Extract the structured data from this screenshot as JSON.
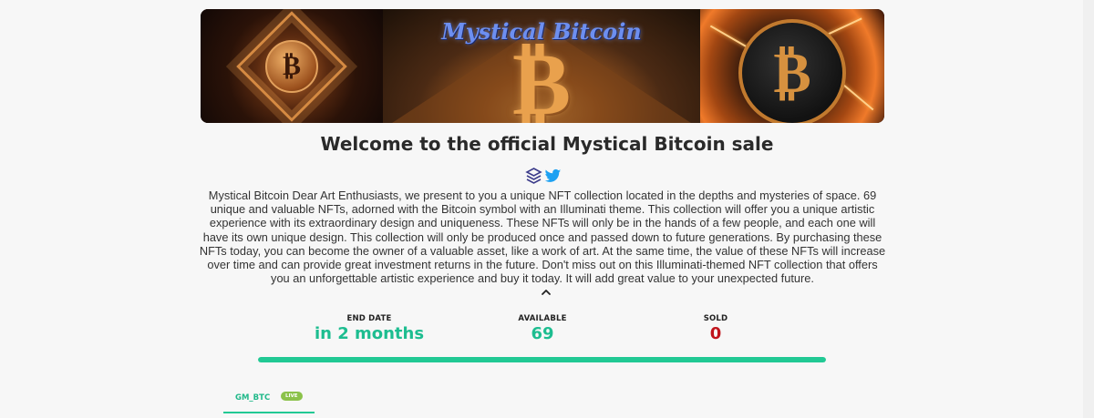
{
  "banner": {
    "title": "Mystical Bitcoin",
    "coin_symbol": "₿"
  },
  "heading": "Welcome to the official Mystical Bitcoin sale",
  "socials": {
    "items": [
      {
        "icon": "layers-icon",
        "color": "#3b3b8a"
      },
      {
        "icon": "twitter-icon",
        "color": "#1da1f2"
      }
    ]
  },
  "description": "Mystical Bitcoin Dear Art Enthusiasts, we present to you a unique NFT collection located in the depths and mysteries of space. 69 unique and valuable NFTs, adorned with the Bitcoin symbol with an Illuminati theme. This collection will offer you a unique artistic experience with its extraordinary design and uniqueness. These NFTs will only be in the hands of a few people, and each one will have its own unique design. This collection will only be produced once and passed down to future generations. By purchasing these NFTs today, you can become the owner of a valuable asset, like a work of art. At the same time, the value of these NFTs will increase over time and can provide great investment returns in the future. Don't miss out on this Illuminati-themed NFT collection that offers you an unforgettable artistic experience and buy it today. It will add great value to your unexpected future.",
  "collapse_icon": "chevron-up-icon",
  "stats": {
    "end_date": {
      "label": "END DATE",
      "value": "in 2 months",
      "color": "#1dbd90"
    },
    "available": {
      "label": "AVAILABLE",
      "value": "69",
      "color": "#1dbd90"
    },
    "sold": {
      "label": "SOLD",
      "value": "0",
      "color": "#c0141c"
    }
  },
  "progress": {
    "fraction": 1.0,
    "color": "#21c994"
  },
  "tabs": [
    {
      "label": "GM_BTC",
      "badge": "LIVE",
      "active": true
    }
  ]
}
